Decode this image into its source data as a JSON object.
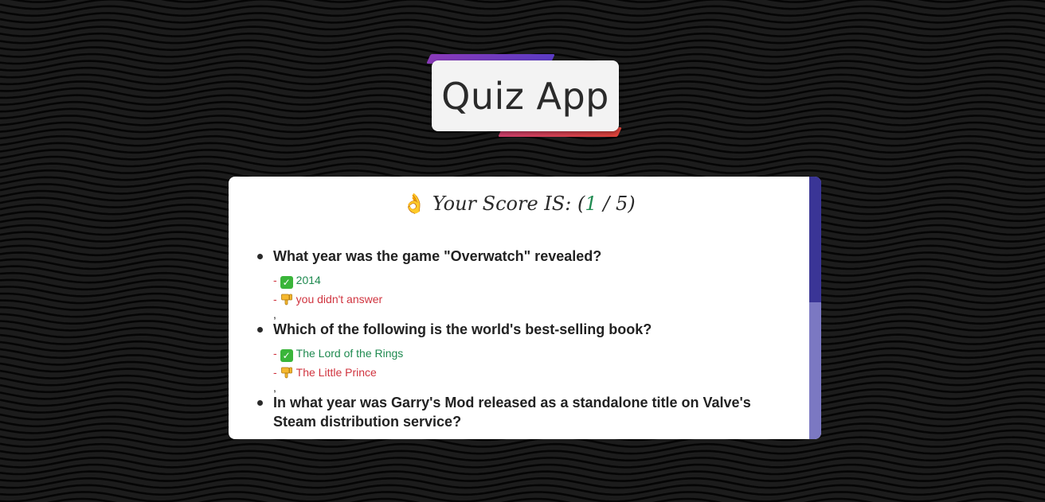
{
  "header": {
    "title": "Quiz App"
  },
  "score": {
    "emoji": "👌",
    "label": "Your Score IS:",
    "open": "(",
    "correct": "1",
    "divider": "/",
    "total": "5",
    "close": ")"
  },
  "results": [
    {
      "question": "What year was the game \"Overwatch\" revealed?",
      "correct_answer": "2014",
      "user_answer": "you didn't answer",
      "separator": ","
    },
    {
      "question": "Which of the following is the world's best-selling book?",
      "correct_answer": "The Lord of the Rings",
      "user_answer": "The Little Prince",
      "separator": ","
    },
    {
      "question": "In what year was Garry's Mod released as a standalone title on Valve's Steam distribution service?"
    }
  ],
  "icons": {
    "correct": "check-mark-icon",
    "user": "thumbs-down-icon",
    "score": "ok-hand-icon"
  },
  "colors": {
    "background": "#1c1c1c",
    "correct": "#1f8a50",
    "wrong": "#d0343f",
    "scroll_track": "#7b78c2",
    "scroll_thumb": "#3a3596",
    "accent_top": "#8a3ab9",
    "accent_bottom": "#e0443b"
  }
}
